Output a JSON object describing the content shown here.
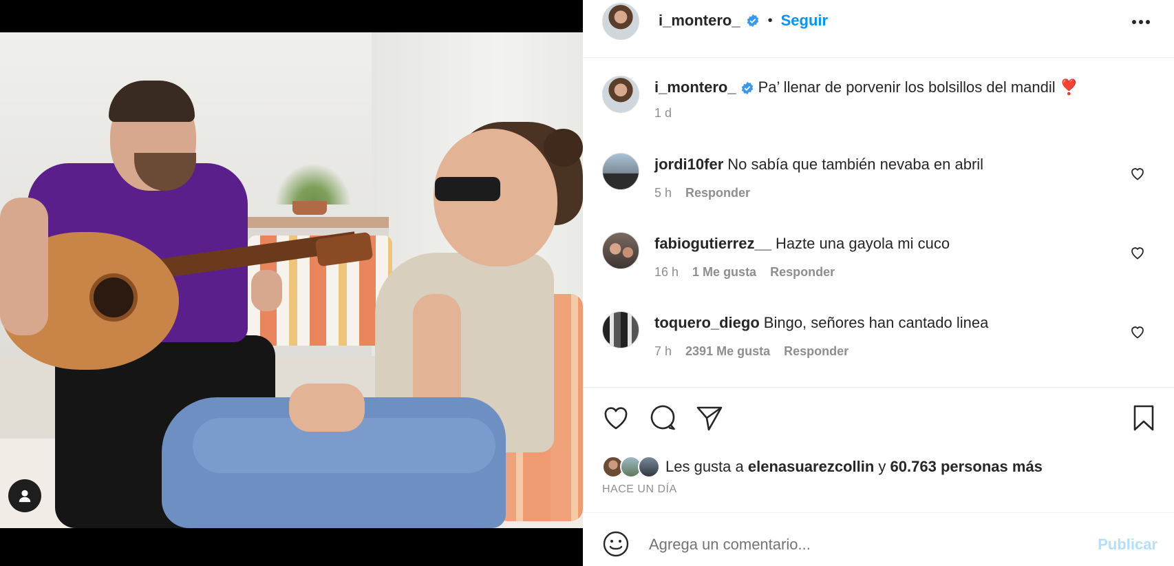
{
  "post": {
    "author": "i_montero_",
    "separator": "•",
    "follow_label": "Seguir",
    "more_icon": "more-horizontal-icon"
  },
  "caption": {
    "username": "i_montero_",
    "text": "Pa’ llenar de porvenir los bolsillos del mandil",
    "emoji": "❣️",
    "time": "1 d"
  },
  "comments": [
    {
      "username": "jordi10fer",
      "text": "No sabía que también nevaba en abril",
      "time": "5 h",
      "likes": "",
      "reply": "Responder"
    },
    {
      "username": "fabiogutierrez__",
      "text": "Hazte una gayola mi cuco",
      "time": "16 h",
      "likes": "1 Me gusta",
      "reply": "Responder"
    },
    {
      "username": "toquero_diego",
      "text": "Bingo, señores han cantado linea",
      "time": "7 h",
      "likes": "2391 Me gusta",
      "reply": "Responder"
    }
  ],
  "likes": {
    "prefix": "Les gusta a",
    "user": "elenasuarezcollin",
    "joiner": "y",
    "count_text": "60.763 personas más"
  },
  "time_ago": "HACE UN DÍA",
  "composer": {
    "placeholder": "Agrega un comentario...",
    "publish_label": "Publicar"
  },
  "colors": {
    "accent": "#0095f6",
    "verified": "#3897f0",
    "publish_disabled": "#b2dffc",
    "heart_emoji": "#ed4956"
  }
}
